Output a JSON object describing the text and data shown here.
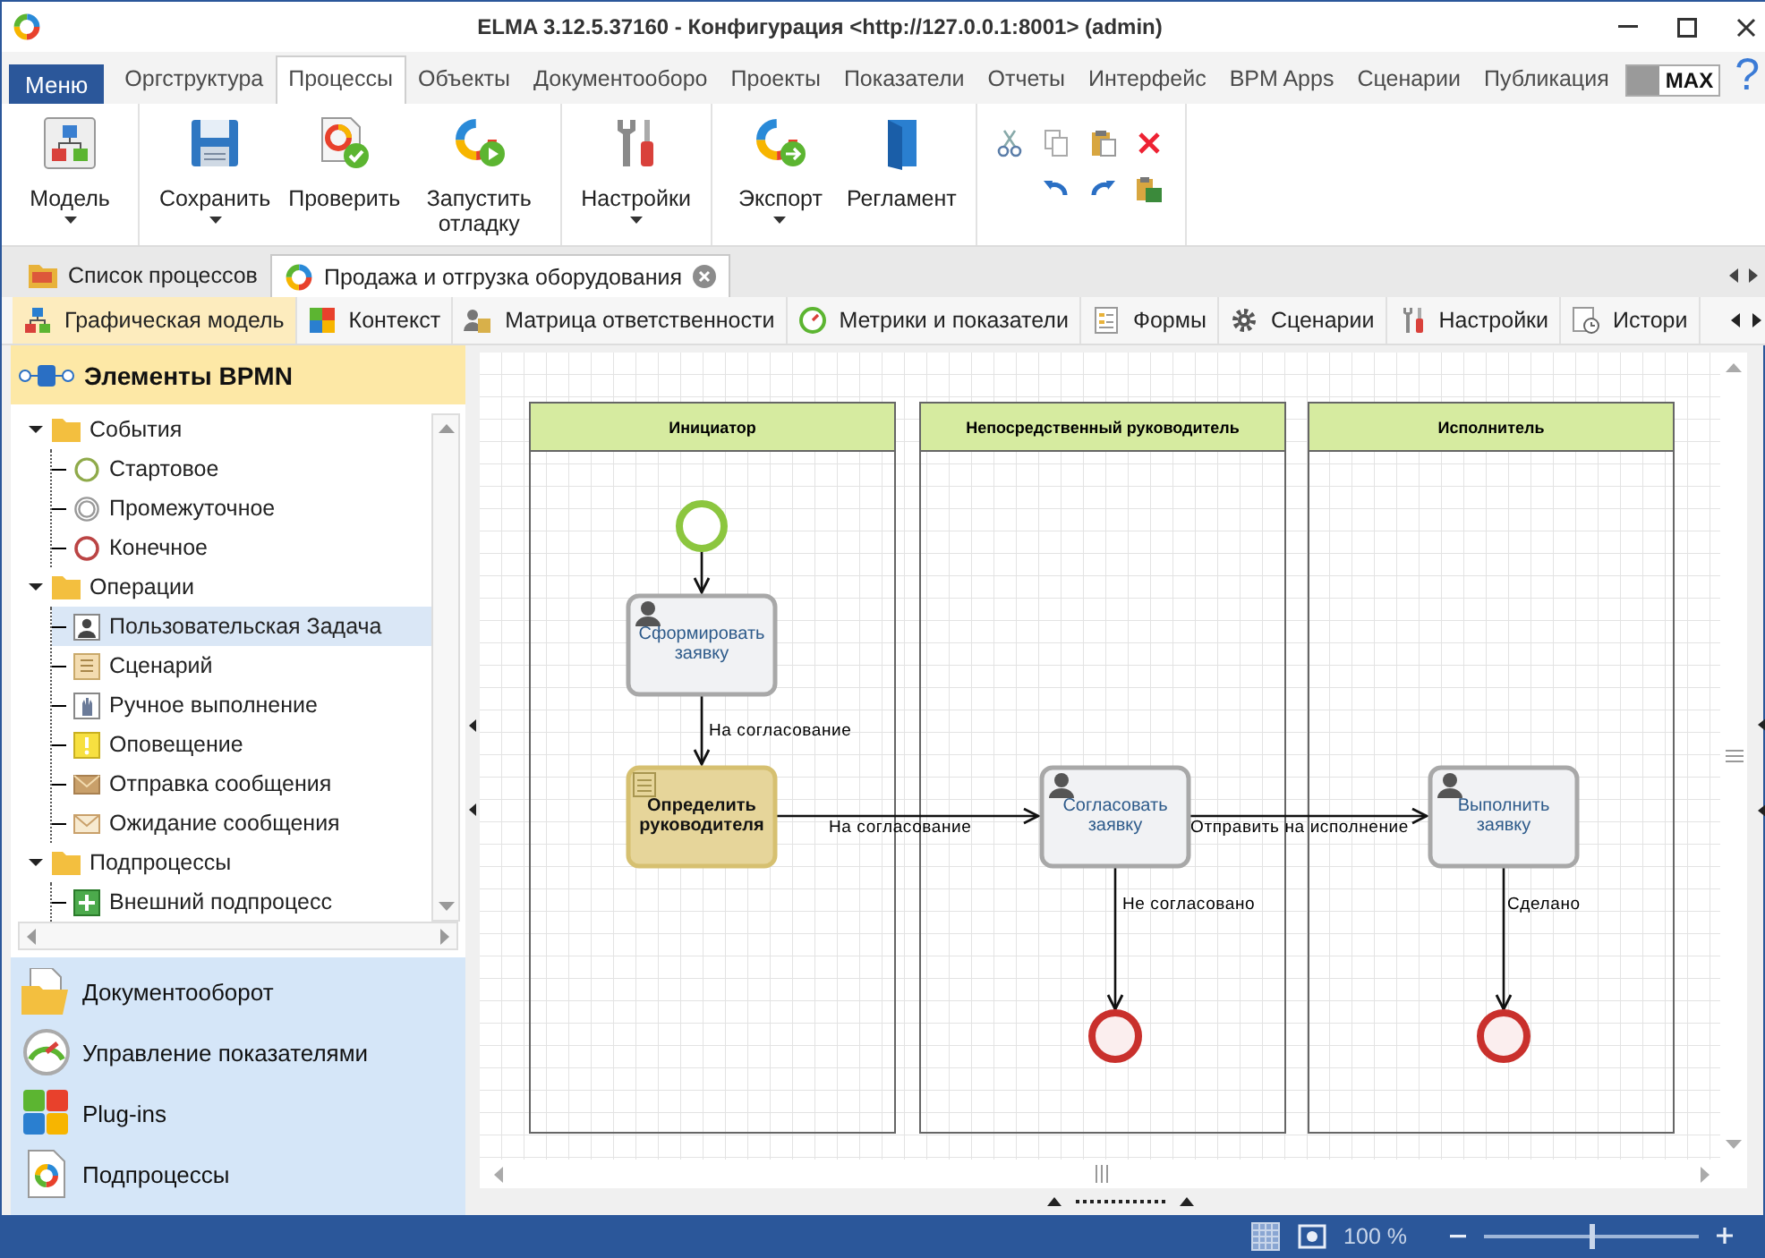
{
  "window": {
    "title": "ELMA 3.12.5.37160 - Конфигурация <http://127.0.0.1:8001> (admin)"
  },
  "menu_button": "Меню",
  "main_tabs": [
    {
      "label": "Оргструктура",
      "selected": false
    },
    {
      "label": "Процессы",
      "selected": true
    },
    {
      "label": "Объекты",
      "selected": false
    },
    {
      "label": "Документооборо",
      "selected": false
    },
    {
      "label": "Проекты",
      "selected": false
    },
    {
      "label": "Показатели",
      "selected": false
    },
    {
      "label": "Отчеты",
      "selected": false
    },
    {
      "label": "Интерфейс",
      "selected": false
    },
    {
      "label": "BPM Apps",
      "selected": false
    },
    {
      "label": "Сценарии",
      "selected": false
    },
    {
      "label": "Публикация",
      "selected": false
    }
  ],
  "max_badge": "MAX",
  "help": "?",
  "ribbon": {
    "groups": [
      {
        "buttons": [
          {
            "label": "Модель",
            "dropdown": true
          }
        ]
      },
      {
        "buttons": [
          {
            "label": "Сохранить",
            "dropdown": true
          },
          {
            "label": "Проверить",
            "dropdown": false
          },
          {
            "label": "Запустить отладку",
            "dropdown": false
          }
        ]
      },
      {
        "buttons": [
          {
            "label": "Настройки",
            "dropdown": true
          }
        ]
      },
      {
        "buttons": [
          {
            "label": "Экспорт",
            "dropdown": true
          },
          {
            "label": "Регламент",
            "dropdown": false
          }
        ]
      }
    ]
  },
  "doc_tabs": [
    {
      "label": "Список процессов",
      "selected": false
    },
    {
      "label": "Продажа и отгрузка оборудования",
      "selected": true
    }
  ],
  "view_tabs": [
    {
      "label": "Графическая модель",
      "selected": true
    },
    {
      "label": "Контекст",
      "selected": false
    },
    {
      "label": "Матрица ответственности",
      "selected": false
    },
    {
      "label": "Метрики и показатели",
      "selected": false
    },
    {
      "label": "Формы",
      "selected": false
    },
    {
      "label": "Сценарии",
      "selected": false
    },
    {
      "label": "Настройки",
      "selected": false
    },
    {
      "label": "Истори",
      "selected": false
    }
  ],
  "sidebar": {
    "title": "Элементы BPMN",
    "tree": [
      {
        "label": "События",
        "expanded": true,
        "children": [
          {
            "label": "Стартовое",
            "selected": false
          },
          {
            "label": "Промежуточное",
            "selected": false
          },
          {
            "label": "Конечное",
            "selected": false
          }
        ]
      },
      {
        "label": "Операции",
        "expanded": true,
        "children": [
          {
            "label": "Пользовательская Задача",
            "selected": true
          },
          {
            "label": "Сценарий",
            "selected": false
          },
          {
            "label": "Ручное выполнение",
            "selected": false
          },
          {
            "label": "Оповещение",
            "selected": false
          },
          {
            "label": "Отправка сообщения",
            "selected": false
          },
          {
            "label": "Ожидание сообщения",
            "selected": false
          }
        ]
      },
      {
        "label": "Подпроцессы",
        "expanded": true,
        "children": [
          {
            "label": "Внешний подпроцесс",
            "selected": false
          }
        ]
      }
    ],
    "sections": [
      "Документооборот",
      "Управление показателями",
      "Plug-ins",
      "Подпроцессы"
    ]
  },
  "diagram": {
    "lanes": [
      "Инициатор",
      "Непосредственный руководитель",
      "Исполнитель"
    ],
    "nodes": [
      {
        "kind": "start"
      },
      {
        "kind": "user-task",
        "label": "Сформировать заявку"
      },
      {
        "kind": "script-task",
        "label": "Определить руководителя"
      },
      {
        "kind": "user-task",
        "label": "Согласовать заявку"
      },
      {
        "kind": "user-task",
        "label": "Выполнить заявку"
      },
      {
        "kind": "end"
      },
      {
        "kind": "end"
      }
    ],
    "flow_labels": [
      "На согласование",
      "На согласование",
      "Отправить на исполнение",
      "Не согласовано",
      "Сделано"
    ]
  },
  "status_bar": {
    "zoom": "100 %",
    "zoom_slider": {
      "level": 0.5
    }
  }
}
